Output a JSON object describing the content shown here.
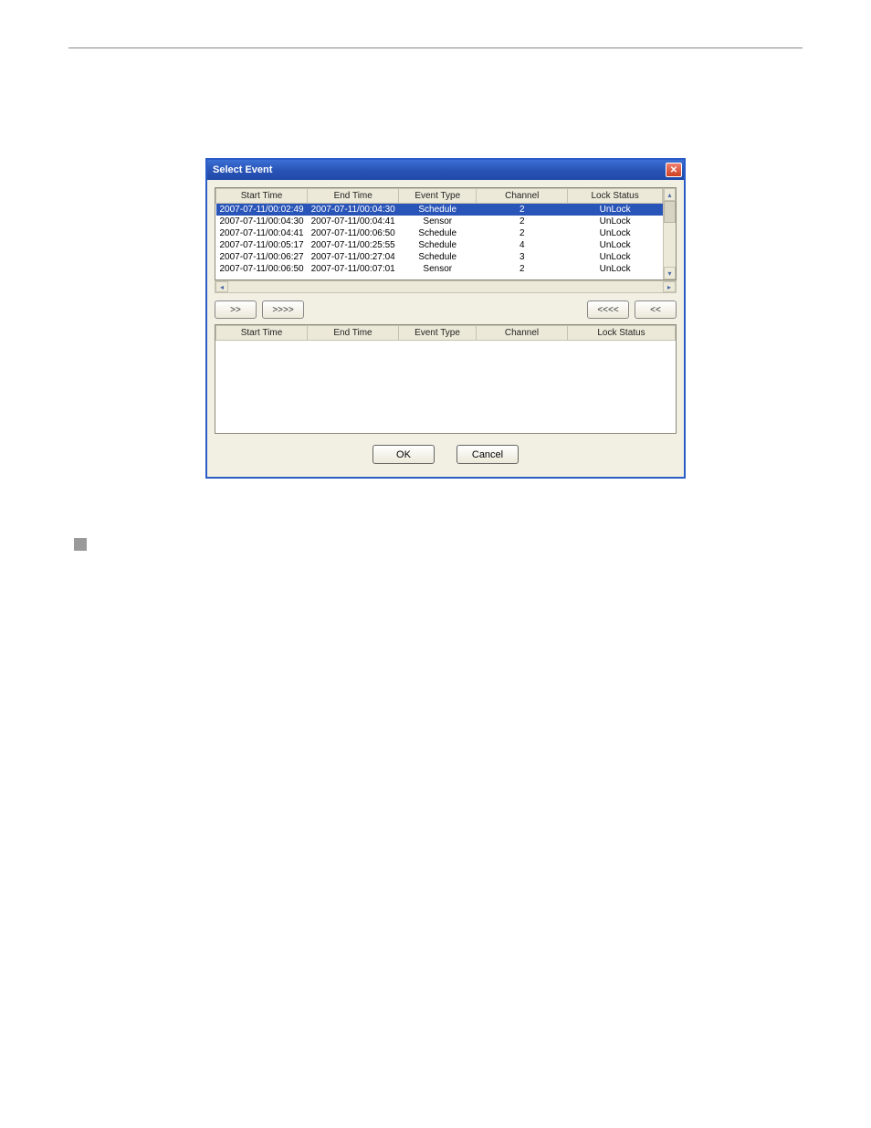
{
  "dialog": {
    "title": "Select Event",
    "close_label": "✕",
    "buttons": {
      "add_one": ">>",
      "add_all": ">>>>",
      "remove_all": "<<<<",
      "remove_one": "<<"
    },
    "footer": {
      "ok": "OK",
      "cancel": "Cancel"
    }
  },
  "columns": {
    "start_time": "Start Time",
    "end_time": "End Time",
    "event_type": "Event Type",
    "channel": "Channel",
    "lock_status": "Lock Status"
  },
  "rows": [
    {
      "start": "2007-07-11/00:02:49",
      "end": "2007-07-11/00:04:30",
      "type": "Schedule",
      "channel": "2",
      "lock": "UnLock",
      "selected": true
    },
    {
      "start": "2007-07-11/00:04:30",
      "end": "2007-07-11/00:04:41",
      "type": "Sensor",
      "channel": "2",
      "lock": "UnLock",
      "selected": false
    },
    {
      "start": "2007-07-11/00:04:41",
      "end": "2007-07-11/00:06:50",
      "type": "Schedule",
      "channel": "2",
      "lock": "UnLock",
      "selected": false
    },
    {
      "start": "2007-07-11/00:05:17",
      "end": "2007-07-11/00:25:55",
      "type": "Schedule",
      "channel": "4",
      "lock": "UnLock",
      "selected": false
    },
    {
      "start": "2007-07-11/00:06:27",
      "end": "2007-07-11/00:27:04",
      "type": "Schedule",
      "channel": "3",
      "lock": "UnLock",
      "selected": false
    },
    {
      "start": "2007-07-11/00:06:50",
      "end": "2007-07-11/00:07:01",
      "type": "Sensor",
      "channel": "2",
      "lock": "UnLock",
      "selected": false
    }
  ],
  "scroll": {
    "up": "▴",
    "down": "▾",
    "left": "◂",
    "right": "▸"
  }
}
